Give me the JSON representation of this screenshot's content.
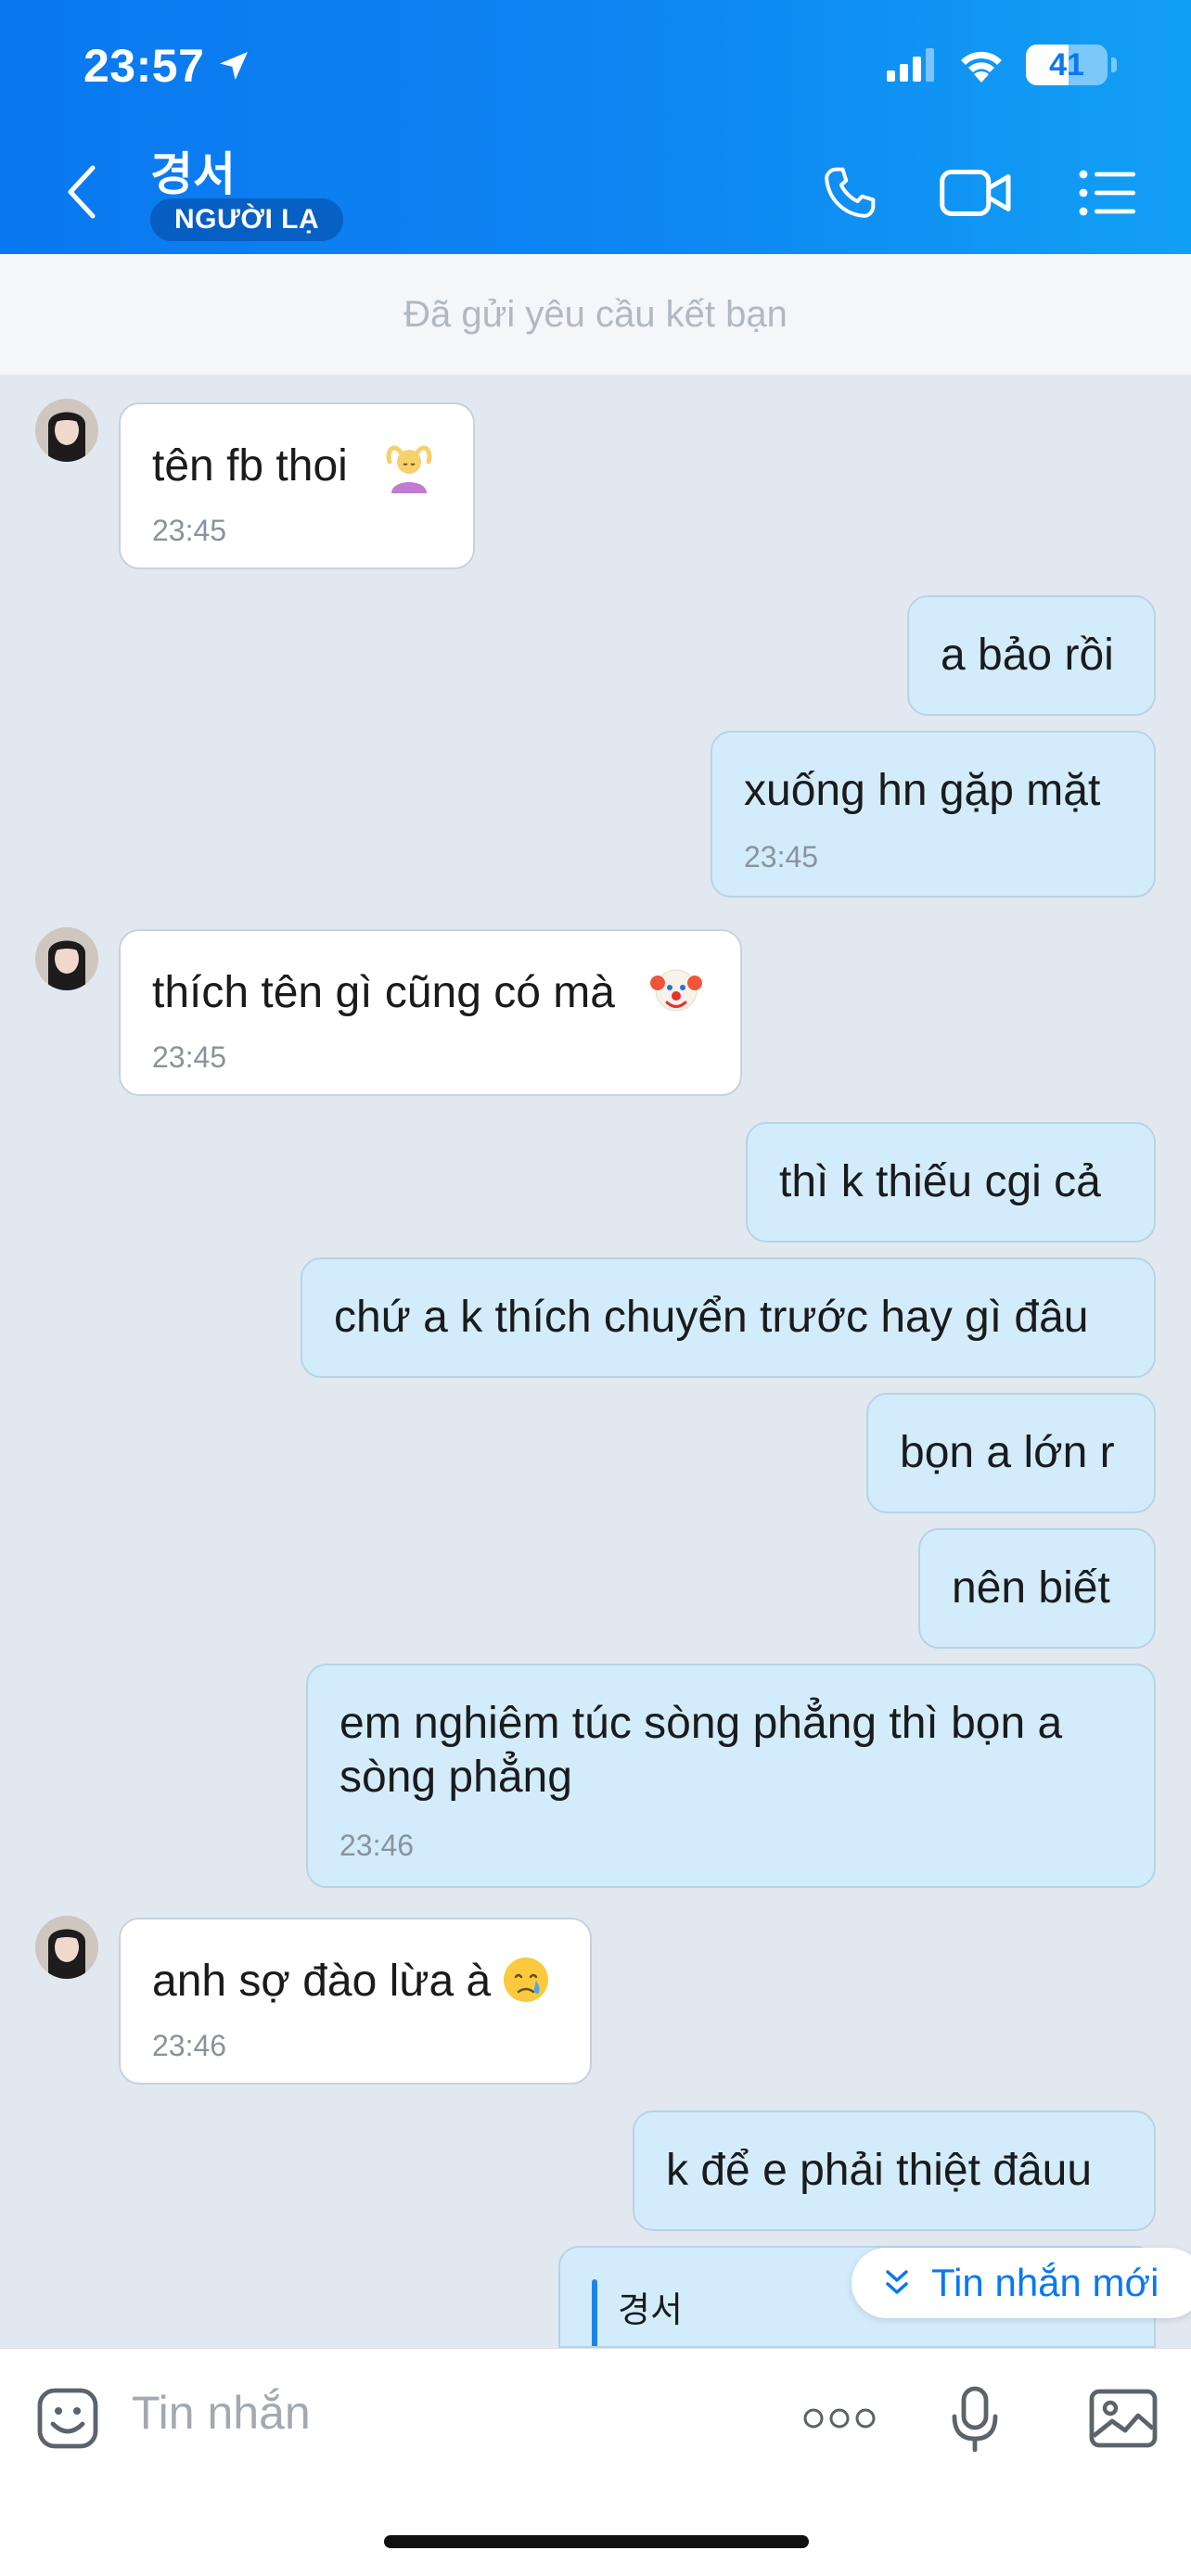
{
  "status_bar": {
    "time": "23:57",
    "battery": "41"
  },
  "header": {
    "contact_name": "경서",
    "contact_badge": "NGƯỜI LẠ"
  },
  "banner": {
    "text": "Đã gửi yêu cầu kết bạn"
  },
  "messages": [
    {
      "side": "in",
      "text": "tên fb thoi",
      "time": "23:45",
      "emoji": "person-gesturing-ok"
    },
    {
      "side": "out",
      "text": "a bảo rồi"
    },
    {
      "side": "out",
      "text": "xuống hn gặp mặt",
      "time": "23:45"
    },
    {
      "side": "in",
      "text": "thích tên gì cũng có mà",
      "time": "23:45",
      "emoji": "clown-face"
    },
    {
      "side": "out",
      "text": "thì k thiếu cgi cả"
    },
    {
      "side": "out",
      "text": "chứ a k thích chuyển trước hay gì đâu"
    },
    {
      "side": "out",
      "text": "bọn a lớn r"
    },
    {
      "side": "out",
      "text": "nên biết"
    },
    {
      "side": "out",
      "text": "em nghiêm túc sòng phẳng thì bọn a",
      "text2": "sòng phẳng",
      "time": "23:46"
    },
    {
      "side": "in",
      "text": "anh sợ đào lừa à",
      "time": "23:46",
      "emoji": "crying-face"
    },
    {
      "side": "out",
      "text": "k để e phải thiệt đâuu"
    }
  ],
  "reply_preview": {
    "name": "경서"
  },
  "new_message_pill": {
    "label": "Tin nhắn mới"
  },
  "composer": {
    "placeholder": "Tin nhắn"
  },
  "colors": {
    "header": "#0a78f0",
    "outgoing_bubble": "#d2ecfc",
    "incoming_bubble": "#ffffff",
    "background": "#e2e8f0"
  }
}
